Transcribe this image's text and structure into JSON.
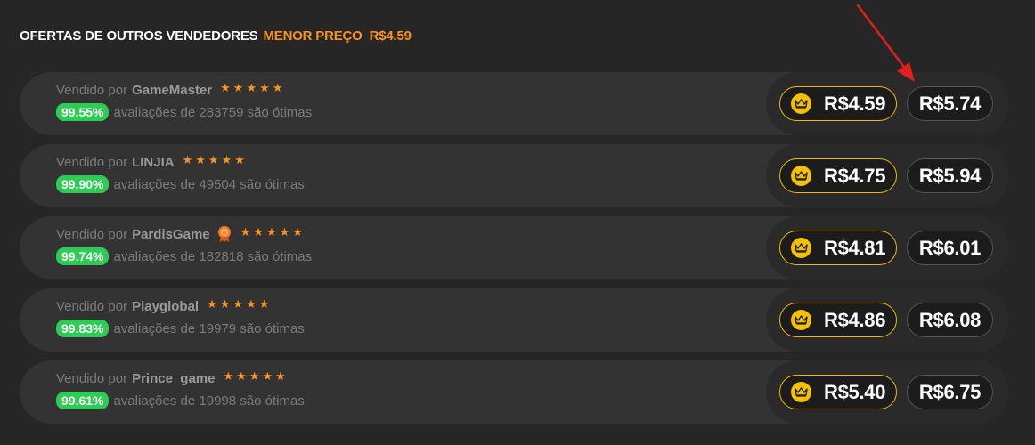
{
  "header": {
    "title": "OFERTAS DE OUTROS VENDEDORES",
    "lowest_label": "MENOR PREÇO",
    "lowest_price": "R$4.59"
  },
  "colors": {
    "accent": "#f7931e",
    "rating_badge": "#2ecc55",
    "member_border": "#f5b800",
    "annotation_arrow": "#e02020"
  },
  "offers": [
    {
      "sold_by": "Vendido por",
      "seller": "GameMaster",
      "has_badge": false,
      "stars": 5,
      "rating_pct": "99.55%",
      "reviews": "avaliações de 283759 são ótimas",
      "member_price": "R$4.59",
      "price": "R$5.74"
    },
    {
      "sold_by": "Vendido por",
      "seller": "LINJIA",
      "has_badge": false,
      "stars": 5,
      "rating_pct": "99.90%",
      "reviews": "avaliações de 49504 são ótimas",
      "member_price": "R$4.75",
      "price": "R$5.94"
    },
    {
      "sold_by": "Vendido por",
      "seller": "PardisGame",
      "has_badge": true,
      "badge_icon": "award-medal-icon",
      "stars": 5,
      "rating_pct": "99.74%",
      "reviews": "avaliações de 182818 são ótimas",
      "member_price": "R$4.81",
      "price": "R$6.01"
    },
    {
      "sold_by": "Vendido por",
      "seller": "Playglobal",
      "has_badge": false,
      "stars": 5,
      "rating_pct": "99.83%",
      "reviews": "avaliações de 19979 são ótimas",
      "member_price": "R$4.86",
      "price": "R$6.08"
    },
    {
      "sold_by": "Vendido por",
      "seller": "Prince_game",
      "has_badge": false,
      "stars": 5,
      "rating_pct": "99.61%",
      "reviews": "avaliações de 19998 são ótimas",
      "member_price": "R$5.40",
      "price": "R$6.75"
    }
  ],
  "icons": {
    "star": "star-icon",
    "member_price": "crown-icon",
    "annotation": "red-arrow-icon"
  }
}
